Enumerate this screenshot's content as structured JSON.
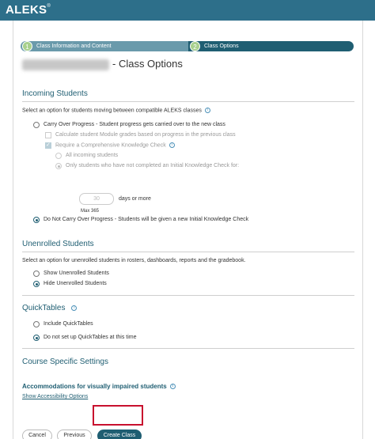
{
  "app": {
    "logo": "ALEKS",
    "logo_mark": "®"
  },
  "stepper": {
    "steps": [
      {
        "num": "1",
        "label": "Class Information and Content"
      },
      {
        "num": "2",
        "label": "Class Options"
      }
    ]
  },
  "page": {
    "title_suffix": "- Class Options"
  },
  "incoming": {
    "title": "Incoming Students",
    "desc": "Select an option for students moving between compatible ALEKS classes",
    "carry_over": "Carry Over Progress - Student progress gets carried over to the new class",
    "calc_module": "Calculate student Module grades based on progress in the previous class",
    "require_check": "Require a Comprehensive Knowledge Check",
    "all_incoming": "All incoming students",
    "only_students": "Only students who have not completed an Initial Knowledge Check for:",
    "days_value": "30",
    "days_label": "days or more",
    "max_label": "Max 365",
    "do_not_carry": "Do Not Carry Over Progress - Students will be given a new Initial Knowledge Check"
  },
  "unenrolled": {
    "title": "Unenrolled Students",
    "desc": "Select an option for unenrolled students in rosters, dashboards, reports and the gradebook.",
    "show": "Show Unenrolled Students",
    "hide": "Hide Unenrolled Students"
  },
  "quicktables": {
    "title": "QuickTables",
    "include": "Include QuickTables",
    "do_not": "Do not set up QuickTables at this time"
  },
  "course_specific": {
    "title": "Course Specific Settings",
    "accommodations": "Accommodations for visually impaired students",
    "show_accessibility": "Show Accessibility Options"
  },
  "buttons": {
    "cancel": "Cancel",
    "previous": "Previous",
    "create": "Create Class"
  },
  "colors": {
    "brand": "#2d6f8a",
    "accent": "#1f5e72",
    "step_done": "#6a9aab",
    "highlight": "#c8102e"
  }
}
